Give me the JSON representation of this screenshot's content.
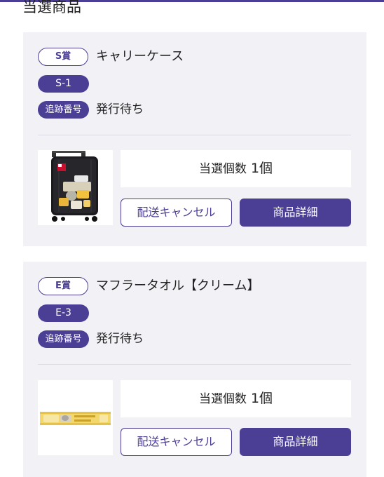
{
  "section_title": "当選商品",
  "colors": {
    "accent": "#4b3f95",
    "card_bg": "#f1f1f6"
  },
  "prizes": [
    {
      "rank": "S賞",
      "name": "キャリーケース",
      "code": "S-1",
      "tracking_label": "追跡番号",
      "tracking_status": "発行待ち",
      "qty_label": "当選個数",
      "qty_value": "1個",
      "cancel_label": "配送キャンセル",
      "detail_label": "商品詳細",
      "thumbnail": "suitcase-image"
    },
    {
      "rank": "E賞",
      "name": "マフラータオル【クリーム】",
      "code": "E-3",
      "tracking_label": "追跡番号",
      "tracking_status": "発行待ち",
      "qty_label": "当選個数",
      "qty_value": "1個",
      "cancel_label": "配送キャンセル",
      "detail_label": "商品詳細",
      "thumbnail": "towel-image"
    }
  ]
}
